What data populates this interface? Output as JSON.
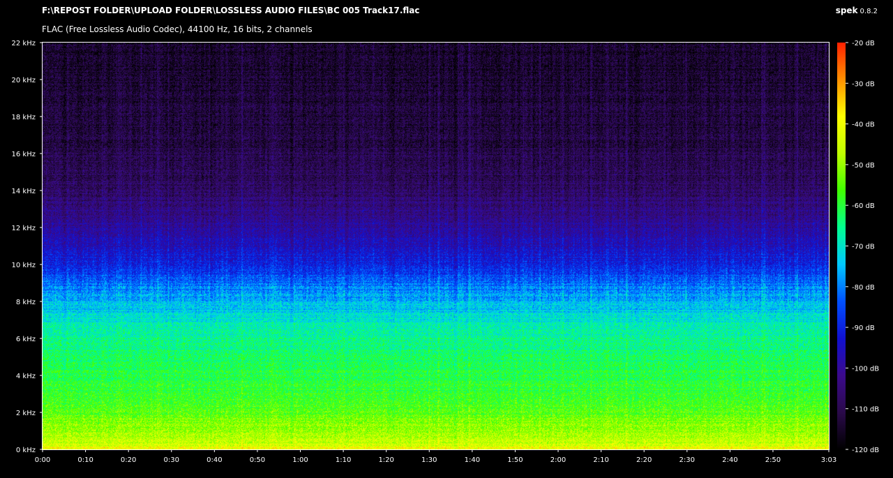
{
  "header": {
    "file_path": "F:\\REPOST FOLDER\\UPLOAD FOLDER\\LOSSLESS AUDIO FILES\\BC 005 Track17.flac",
    "file_info": "FLAC (Free Lossless Audio Codec), 44100 Hz, 16 bits, 2 channels",
    "app_name": "spek",
    "app_version": "0.8.2"
  },
  "chart_data": {
    "type": "heatmap",
    "title": "",
    "x_ticks": [
      "0:00",
      "0:10",
      "0:20",
      "0:30",
      "0:40",
      "0:50",
      "1:00",
      "1:10",
      "1:20",
      "1:30",
      "1:40",
      "1:50",
      "2:00",
      "2:10",
      "2:20",
      "2:30",
      "2:40",
      "2:50",
      "3:03"
    ],
    "x_tick_seconds": [
      0,
      10,
      20,
      30,
      40,
      50,
      60,
      70,
      80,
      90,
      100,
      110,
      120,
      130,
      140,
      150,
      160,
      170,
      183
    ],
    "xlim_seconds": [
      0,
      183
    ],
    "y_ticks": [
      "0 kHz",
      "2 kHz",
      "4 kHz",
      "6 kHz",
      "8 kHz",
      "10 kHz",
      "12 kHz",
      "14 kHz",
      "16 kHz",
      "18 kHz",
      "20 kHz",
      "22 kHz"
    ],
    "y_tick_khz": [
      0,
      2,
      4,
      6,
      8,
      10,
      12,
      14,
      16,
      18,
      20,
      22
    ],
    "ylim_khz": [
      0,
      22
    ],
    "colorbar_ticks": [
      "-20 dB",
      "-30 dB",
      "-40 dB",
      "-50 dB",
      "-60 dB",
      "-70 dB",
      "-80 dB",
      "-90 dB",
      "-100 dB",
      "-110 dB",
      "-120 dB"
    ],
    "colorbar_db": [
      -20,
      -30,
      -40,
      -50,
      -60,
      -70,
      -80,
      -90,
      -100,
      -110,
      -120
    ],
    "colorbar_range_db": [
      -120,
      -20
    ],
    "colormap": [
      "#000000",
      "#2a0a4a",
      "#3b0a8c",
      "#1010d0",
      "#0050ff",
      "#00c8ff",
      "#00ff90",
      "#40ff00",
      "#c0ff00",
      "#ffff00",
      "#ff9000",
      "#ff2000"
    ],
    "intensity_profile_db": {
      "freq_khz": [
        0,
        0.3,
        1,
        2,
        3,
        4,
        5,
        6,
        7,
        8,
        9,
        10,
        11,
        12,
        13,
        14,
        16,
        18,
        20,
        22
      ],
      "level_db": [
        -38,
        -45,
        -50,
        -55,
        -58,
        -60,
        -63,
        -66,
        -70,
        -76,
        -82,
        -90,
        -96,
        -100,
        -104,
        -108,
        -111,
        -113,
        -114,
        -115
      ]
    }
  }
}
